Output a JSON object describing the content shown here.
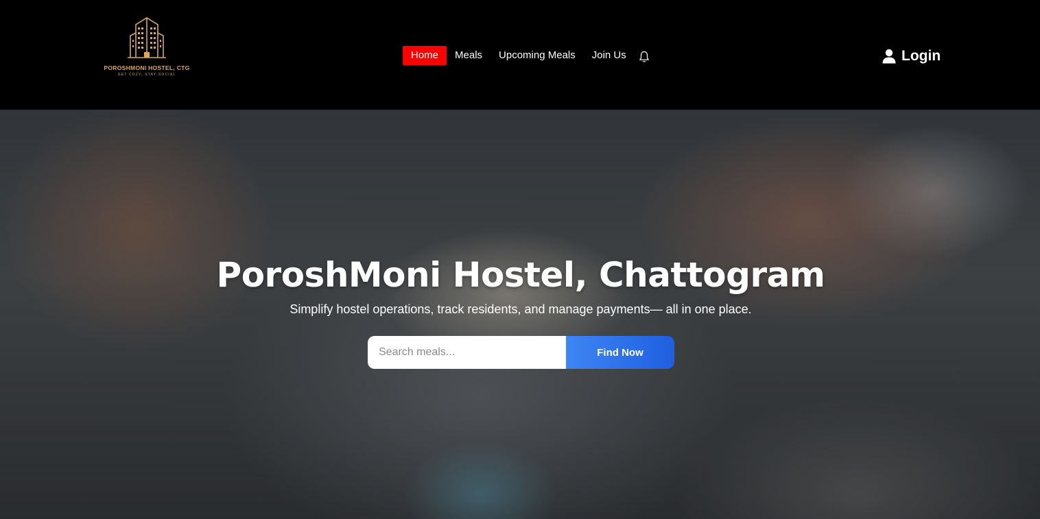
{
  "brand": {
    "name": "POROSHMONI HOSTEL, CTG",
    "tagline": "GET COZY, STAY SOCIAL",
    "color": "#d9a85b"
  },
  "nav": {
    "items": [
      {
        "label": "Home",
        "active": true
      },
      {
        "label": "Meals",
        "active": false
      },
      {
        "label": "Upcoming Meals",
        "active": false
      },
      {
        "label": "Join Us",
        "active": false
      }
    ],
    "notification_icon": "bell-icon",
    "active_color": "#ff0000"
  },
  "auth": {
    "login_label": "Login",
    "icon": "user-icon"
  },
  "hero": {
    "title": "PoroshMoni Hostel, Chattogram",
    "subtitle": "Simplify hostel operations, track residents, and manage payments— all in one place.",
    "search": {
      "placeholder": "Search meals...",
      "value": "",
      "button_label": "Find Now",
      "button_color": "#2f6ff0"
    }
  }
}
